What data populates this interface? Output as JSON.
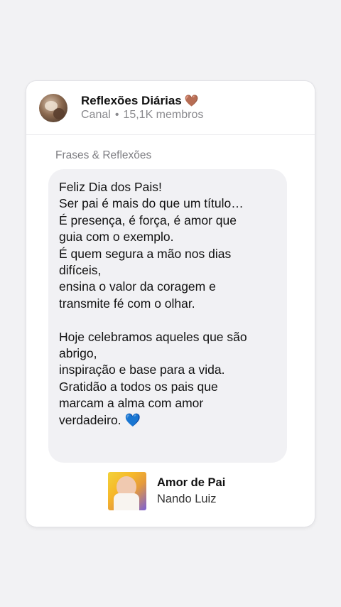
{
  "channel": {
    "name": "Reflexões Diárias",
    "name_emoji": "🤎",
    "type": "Canal",
    "separator": "•",
    "members": "15,1K membros"
  },
  "post": {
    "section_label": "Frases & Reflexões",
    "lines": [
      "Feliz Dia dos Pais!",
      "Ser pai é mais do que um título…",
      "É presença, é força, é amor que",
      "guia com o exemplo.",
      "É quem segura a mão nos dias",
      "difíceis,",
      "ensina o valor da coragem e",
      "transmite fé com o olhar.",
      "",
      "Hoje celebramos aqueles que são",
      "abrigo,",
      "inspiração e base para a vida.",
      "Gratidão a todos os pais que",
      "marcam a alma com amor",
      "verdadeiro."
    ],
    "end_emoji": "💙"
  },
  "music": {
    "title": "Amor de Pai",
    "artist": "Nando Luiz"
  }
}
